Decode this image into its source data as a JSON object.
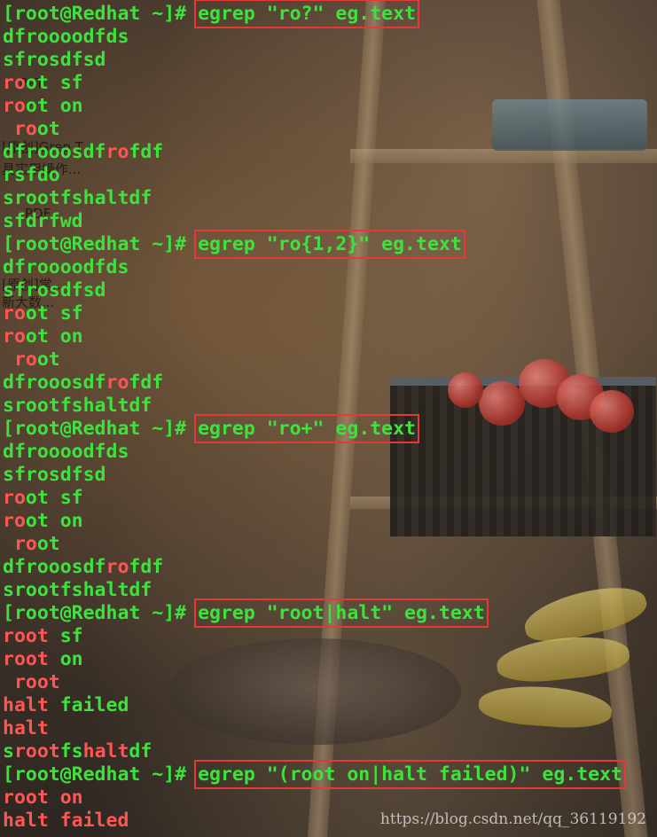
{
  "lines": [
    {
      "segs": [
        {
          "t": "[root@Redhat ~]# ",
          "c": "g"
        },
        {
          "t": "egrep \"ro?\" eg.text",
          "c": "g",
          "box": true
        }
      ]
    },
    {
      "segs": [
        {
          "t": "dfrooo",
          "c": "g"
        },
        {
          "t": "odfds",
          "c": "g"
        }
      ]
    },
    {
      "segs": [
        {
          "t": "sfrosdfsd",
          "c": "g"
        }
      ]
    },
    {
      "segs": [
        {
          "t": "ro",
          "c": "r"
        },
        {
          "t": "ot sf",
          "c": "g"
        }
      ]
    },
    {
      "segs": [
        {
          "t": "ro",
          "c": "r"
        },
        {
          "t": "ot on",
          "c": "g"
        }
      ]
    },
    {
      "segs": [
        {
          "t": " ro",
          "c": "r"
        },
        {
          "t": "ot",
          "c": "g"
        }
      ]
    },
    {
      "segs": [
        {
          "t": "dfrooosdf",
          "c": "g"
        },
        {
          "t": "ro",
          "c": "r"
        },
        {
          "t": "fdf",
          "c": "g"
        }
      ]
    },
    {
      "segs": [
        {
          "t": "rsfdo",
          "c": "g"
        }
      ]
    },
    {
      "segs": [
        {
          "t": "sro",
          "c": "g"
        },
        {
          "t": "otfshaltdf",
          "c": "g"
        }
      ]
    },
    {
      "segs": [
        {
          "t": "sfdrfwd",
          "c": "g"
        }
      ]
    },
    {
      "segs": [
        {
          "t": "[root@Redhat ~]# ",
          "c": "g"
        },
        {
          "t": "egrep \"ro{1,2}\" eg.text",
          "c": "g",
          "box": true
        }
      ]
    },
    {
      "segs": [
        {
          "t": "dfroooodfds",
          "c": "g"
        }
      ]
    },
    {
      "segs": [
        {
          "t": "sfrosdfsd",
          "c": "g"
        }
      ]
    },
    {
      "segs": [
        {
          "t": "ro",
          "c": "r"
        },
        {
          "t": "ot sf",
          "c": "g"
        }
      ]
    },
    {
      "segs": [
        {
          "t": "ro",
          "c": "r"
        },
        {
          "t": "ot on",
          "c": "g"
        }
      ]
    },
    {
      "segs": [
        {
          "t": " ro",
          "c": "r"
        },
        {
          "t": "ot",
          "c": "g"
        }
      ]
    },
    {
      "segs": [
        {
          "t": "dfrooosdf",
          "c": "g"
        },
        {
          "t": "ro",
          "c": "r"
        },
        {
          "t": "fdf",
          "c": "g"
        }
      ]
    },
    {
      "segs": [
        {
          "t": "srootfshaltdf",
          "c": "g"
        }
      ]
    },
    {
      "segs": [
        {
          "t": "[root@Redhat ~]# ",
          "c": "g"
        },
        {
          "t": "egrep \"ro+\" eg.text",
          "c": "g",
          "box": true
        }
      ]
    },
    {
      "segs": [
        {
          "t": "dfroooodfds",
          "c": "g"
        }
      ]
    },
    {
      "segs": [
        {
          "t": "sfrosdfsd",
          "c": "g"
        }
      ]
    },
    {
      "segs": [
        {
          "t": "ro",
          "c": "r"
        },
        {
          "t": "ot sf",
          "c": "g"
        }
      ]
    },
    {
      "segs": [
        {
          "t": "ro",
          "c": "r"
        },
        {
          "t": "ot on",
          "c": "g"
        }
      ]
    },
    {
      "segs": [
        {
          "t": " ro",
          "c": "r"
        },
        {
          "t": "ot",
          "c": "g"
        }
      ]
    },
    {
      "segs": [
        {
          "t": "dfrooosdf",
          "c": "g"
        },
        {
          "t": "ro",
          "c": "r"
        },
        {
          "t": "fdf",
          "c": "g"
        }
      ]
    },
    {
      "segs": [
        {
          "t": "srootfshaltdf",
          "c": "g"
        }
      ]
    },
    {
      "segs": [
        {
          "t": "[root@Redhat ~]# ",
          "c": "g"
        },
        {
          "t": "egrep \"root|halt\" eg.text",
          "c": "g",
          "box": true
        }
      ]
    },
    {
      "segs": [
        {
          "t": "root",
          "c": "r"
        },
        {
          "t": " sf",
          "c": "g"
        }
      ]
    },
    {
      "segs": [
        {
          "t": "root",
          "c": "r"
        },
        {
          "t": " on",
          "c": "g"
        }
      ]
    },
    {
      "segs": [
        {
          "t": " ",
          "c": "g"
        },
        {
          "t": "root",
          "c": "r"
        }
      ]
    },
    {
      "segs": [
        {
          "t": "halt",
          "c": "r"
        },
        {
          "t": " failed",
          "c": "g"
        }
      ]
    },
    {
      "segs": [
        {
          "t": "halt",
          "c": "r"
        }
      ]
    },
    {
      "segs": [
        {
          "t": "s",
          "c": "g"
        },
        {
          "t": "root",
          "c": "r"
        },
        {
          "t": "fs",
          "c": "g"
        },
        {
          "t": "halt",
          "c": "r"
        },
        {
          "t": "df",
          "c": "g"
        }
      ]
    },
    {
      "segs": [
        {
          "t": "[root@Redhat ~]# ",
          "c": "g"
        },
        {
          "t": "egrep \"(root on|halt failed)\" eg.text",
          "c": "g",
          "box": true
        }
      ]
    },
    {
      "segs": [
        {
          "t": "root on",
          "c": "r"
        }
      ]
    },
    {
      "segs": [
        {
          "t": "halt failed",
          "c": "r"
        }
      ]
    }
  ],
  "background": {
    "ghost_texts": [
      "[原创]Grep T",
      "具实用操作...",
      "PDF",
      "[原创]常...",
      "新大数...",
      "PPT"
    ]
  },
  "watermark": "https://blog.csdn.net/qq_36119192",
  "colors": {
    "prompt": "#3ee23e",
    "match": "#ff5555",
    "highlight_box": "#e53935"
  }
}
